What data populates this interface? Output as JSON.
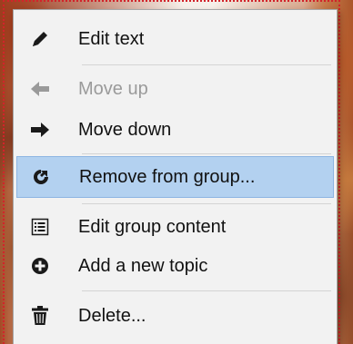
{
  "menu": {
    "items": [
      {
        "label": "Edit text",
        "icon": "pencil-icon",
        "enabled": true,
        "highlighted": false
      },
      {
        "label": "Move up",
        "icon": "arrow-left-icon",
        "enabled": false,
        "highlighted": false
      },
      {
        "label": "Move down",
        "icon": "arrow-right-icon",
        "enabled": true,
        "highlighted": false
      },
      {
        "label": "Remove from group...",
        "icon": "share-out-icon",
        "enabled": true,
        "highlighted": true
      },
      {
        "label": "Edit group content",
        "icon": "list-icon",
        "enabled": true,
        "highlighted": false
      },
      {
        "label": "Add a new topic",
        "icon": "plus-circle-icon",
        "enabled": true,
        "highlighted": false
      },
      {
        "label": "Delete...",
        "icon": "trash-icon",
        "enabled": true,
        "highlighted": false
      }
    ]
  },
  "colors": {
    "highlight": "#b3d1f0",
    "disabled_text": "#9a9a9a",
    "selection_outline": "#d2232a"
  }
}
